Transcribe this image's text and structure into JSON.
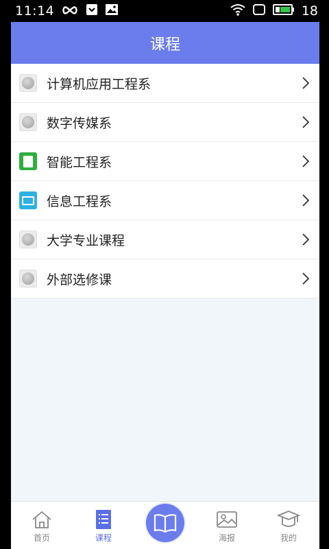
{
  "status_bar": {
    "time": "11:14",
    "battery_level": "18"
  },
  "header": {
    "title": "课程"
  },
  "courses": [
    {
      "label": "计算机应用工程系",
      "icon": "coin-icon"
    },
    {
      "label": "数字传媒系",
      "icon": "coin-icon"
    },
    {
      "label": "智能工程系",
      "icon": "notebook-icon"
    },
    {
      "label": "信息工程系",
      "icon": "monitor-icon"
    },
    {
      "label": "大学专业课程",
      "icon": "coin-icon"
    },
    {
      "label": "外部选修课",
      "icon": "coin-icon"
    }
  ],
  "tabbar": {
    "items": [
      {
        "label": "首页",
        "icon": "home-icon",
        "active": false
      },
      {
        "label": "课程",
        "icon": "list-icon",
        "active": true
      },
      {
        "label": "",
        "icon": "book-icon",
        "active": false
      },
      {
        "label": "海报",
        "icon": "image-icon",
        "active": false
      },
      {
        "label": "我的",
        "icon": "graduation-cap-icon",
        "active": false
      }
    ]
  },
  "colors": {
    "accent": "#6b7ded",
    "background": "#f1f6fb",
    "active_tab": "#5a6fe6"
  }
}
